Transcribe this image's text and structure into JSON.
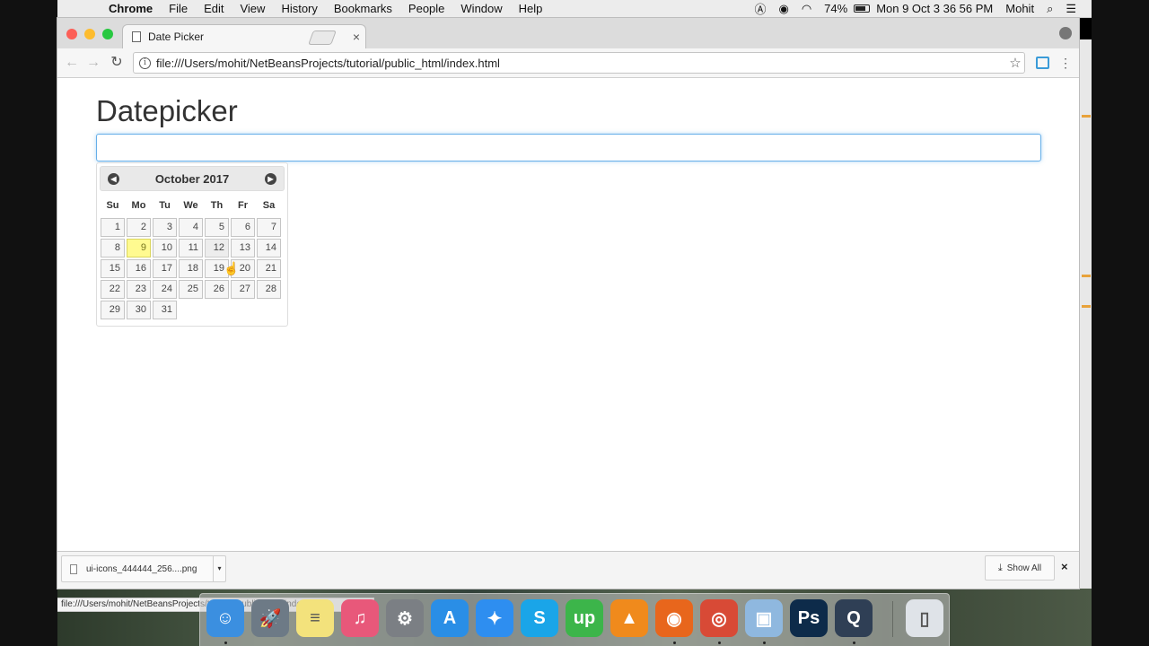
{
  "menubar": {
    "app_name": "Chrome",
    "items": [
      "File",
      "Edit",
      "View",
      "History",
      "Bookmarks",
      "People",
      "Window",
      "Help"
    ],
    "battery": "74%",
    "clock": "Mon 9 Oct  3 36 56 PM",
    "user": "Mohit"
  },
  "browser": {
    "tab_title": "Date Picker",
    "tab_close": "×",
    "url": "file:///Users/mohit/NetBeansProjects/tutorial/public_html/index.html"
  },
  "page": {
    "heading": "Datepicker",
    "input_value": ""
  },
  "datepicker": {
    "month_label": "October 2017",
    "prev_label": "◀",
    "next_label": "▶",
    "weekdays": [
      "Su",
      "Mo",
      "Tu",
      "We",
      "Th",
      "Fr",
      "Sa"
    ],
    "weeks": [
      [
        "1",
        "2",
        "3",
        "4",
        "5",
        "6",
        "7"
      ],
      [
        "8",
        "9",
        "10",
        "11",
        "12",
        "13",
        "14"
      ],
      [
        "15",
        "16",
        "17",
        "18",
        "19",
        "20",
        "21"
      ],
      [
        "22",
        "23",
        "24",
        "25",
        "26",
        "27",
        "28"
      ],
      [
        "29",
        "30",
        "31",
        "",
        "",
        "",
        ""
      ]
    ],
    "today": "9",
    "hovered": "12"
  },
  "status_bar": {
    "url": "file:///Users/mohit/NetBeansProjects/tutorial/public_html/index.html#"
  },
  "download_shelf": {
    "file_name": "ui-icons_444444_256....png",
    "show_all": "Show All",
    "close": "×"
  },
  "dock": {
    "apps": [
      {
        "name": "finder-icon",
        "color": "#3b8fe0",
        "glyph": "☺",
        "dot": true
      },
      {
        "name": "launchpad-icon",
        "color": "#6d7a86",
        "glyph": "🚀",
        "dot": false
      },
      {
        "name": "notes-icon",
        "color": "#f3e27c",
        "glyph": "≡",
        "dot": false
      },
      {
        "name": "itunes-icon",
        "color": "#e8587a",
        "glyph": "♫",
        "dot": false
      },
      {
        "name": "system-preferences-icon",
        "color": "#7b7f84",
        "glyph": "⚙",
        "dot": false
      },
      {
        "name": "app-store-icon",
        "color": "#2a8ee6",
        "glyph": "A",
        "dot": false
      },
      {
        "name": "safari-icon",
        "color": "#2e8ef0",
        "glyph": "✦",
        "dot": false
      },
      {
        "name": "skype-icon",
        "color": "#1aa5e8",
        "glyph": "S",
        "dot": false
      },
      {
        "name": "upwork-icon",
        "color": "#3cb54a",
        "glyph": "up",
        "dot": false
      },
      {
        "name": "vlc-icon",
        "color": "#f08a1c",
        "glyph": "▲",
        "dot": false
      },
      {
        "name": "firefox-icon",
        "color": "#e8661c",
        "glyph": "◉",
        "dot": true
      },
      {
        "name": "chrome-icon",
        "color": "#d84a36",
        "glyph": "◎",
        "dot": true
      },
      {
        "name": "virtualbox-icon",
        "color": "#8fb8df",
        "glyph": "▣",
        "dot": true
      },
      {
        "name": "photoshop-icon",
        "color": "#0d2b4a",
        "glyph": "Ps",
        "dot": false
      },
      {
        "name": "quicktime-icon",
        "color": "#2f3f55",
        "glyph": "Q",
        "dot": true
      },
      {
        "name": "trash-icon",
        "color": "#dfe3e8",
        "glyph": "▯",
        "dot": false
      }
    ]
  }
}
